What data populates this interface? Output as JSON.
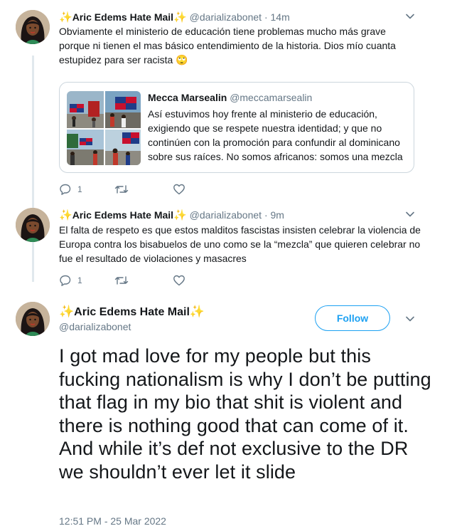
{
  "thread": [
    {
      "display_name": "Aric Edems Hate Mail",
      "name_prefix_emoji": "✨",
      "name_suffix_emoji": "✨",
      "handle": "@darializabonet",
      "time": "14m",
      "text": "Obviamente el ministerio de educación tiene problemas mucho más grave porque ni tienen el mas básico entendimiento de la historia. Dios mío cuanta estupidez para ser racista 🙄",
      "quote": {
        "display_name": "Mecca Marsealin",
        "handle": "@meccamarsealin",
        "text": "Así estuvimos hoy frente al ministerio de educación, exigiendo que se respete nuestra identidad; y que no continúen con la promoción para confundir al dominicano sobre sus raíces. No somos africanos: somos una mezcla"
      },
      "reply_count": "1"
    },
    {
      "display_name": "Aric Edems Hate Mail",
      "name_prefix_emoji": "✨",
      "name_suffix_emoji": "✨",
      "handle": "@darializabonet",
      "time": "9m",
      "text": "El falta de respeto es que estos malditos fascistas insisten celebrar la violencia de Europa contra los bisabuelos de uno como se la “mezcla” que quieren celebrar no fue el resultado de violaciones y masacres",
      "reply_count": "1"
    }
  ],
  "main_tweet": {
    "display_name": "Aric Edems Hate Mail",
    "name_prefix_emoji": "✨",
    "name_suffix_emoji": "✨",
    "handle": "@darializabonet",
    "follow_label": "Follow",
    "text": "I got mad love for my people but this fucking nationalism is why I don’t be putting that flag in my bio that shit is violent and there is nothing good that can come of it. And while it’s def not exclusive to the DR we shouldn’t ever let it slide",
    "timestamp": "12:51 PM - 25 Mar 2022"
  },
  "separator_dot": "·",
  "colors": {
    "link_blue": "#1da1f2",
    "muted": "#657786",
    "text": "#14171a",
    "border": "#ccd6dd",
    "sparkle": "#f5b800"
  }
}
